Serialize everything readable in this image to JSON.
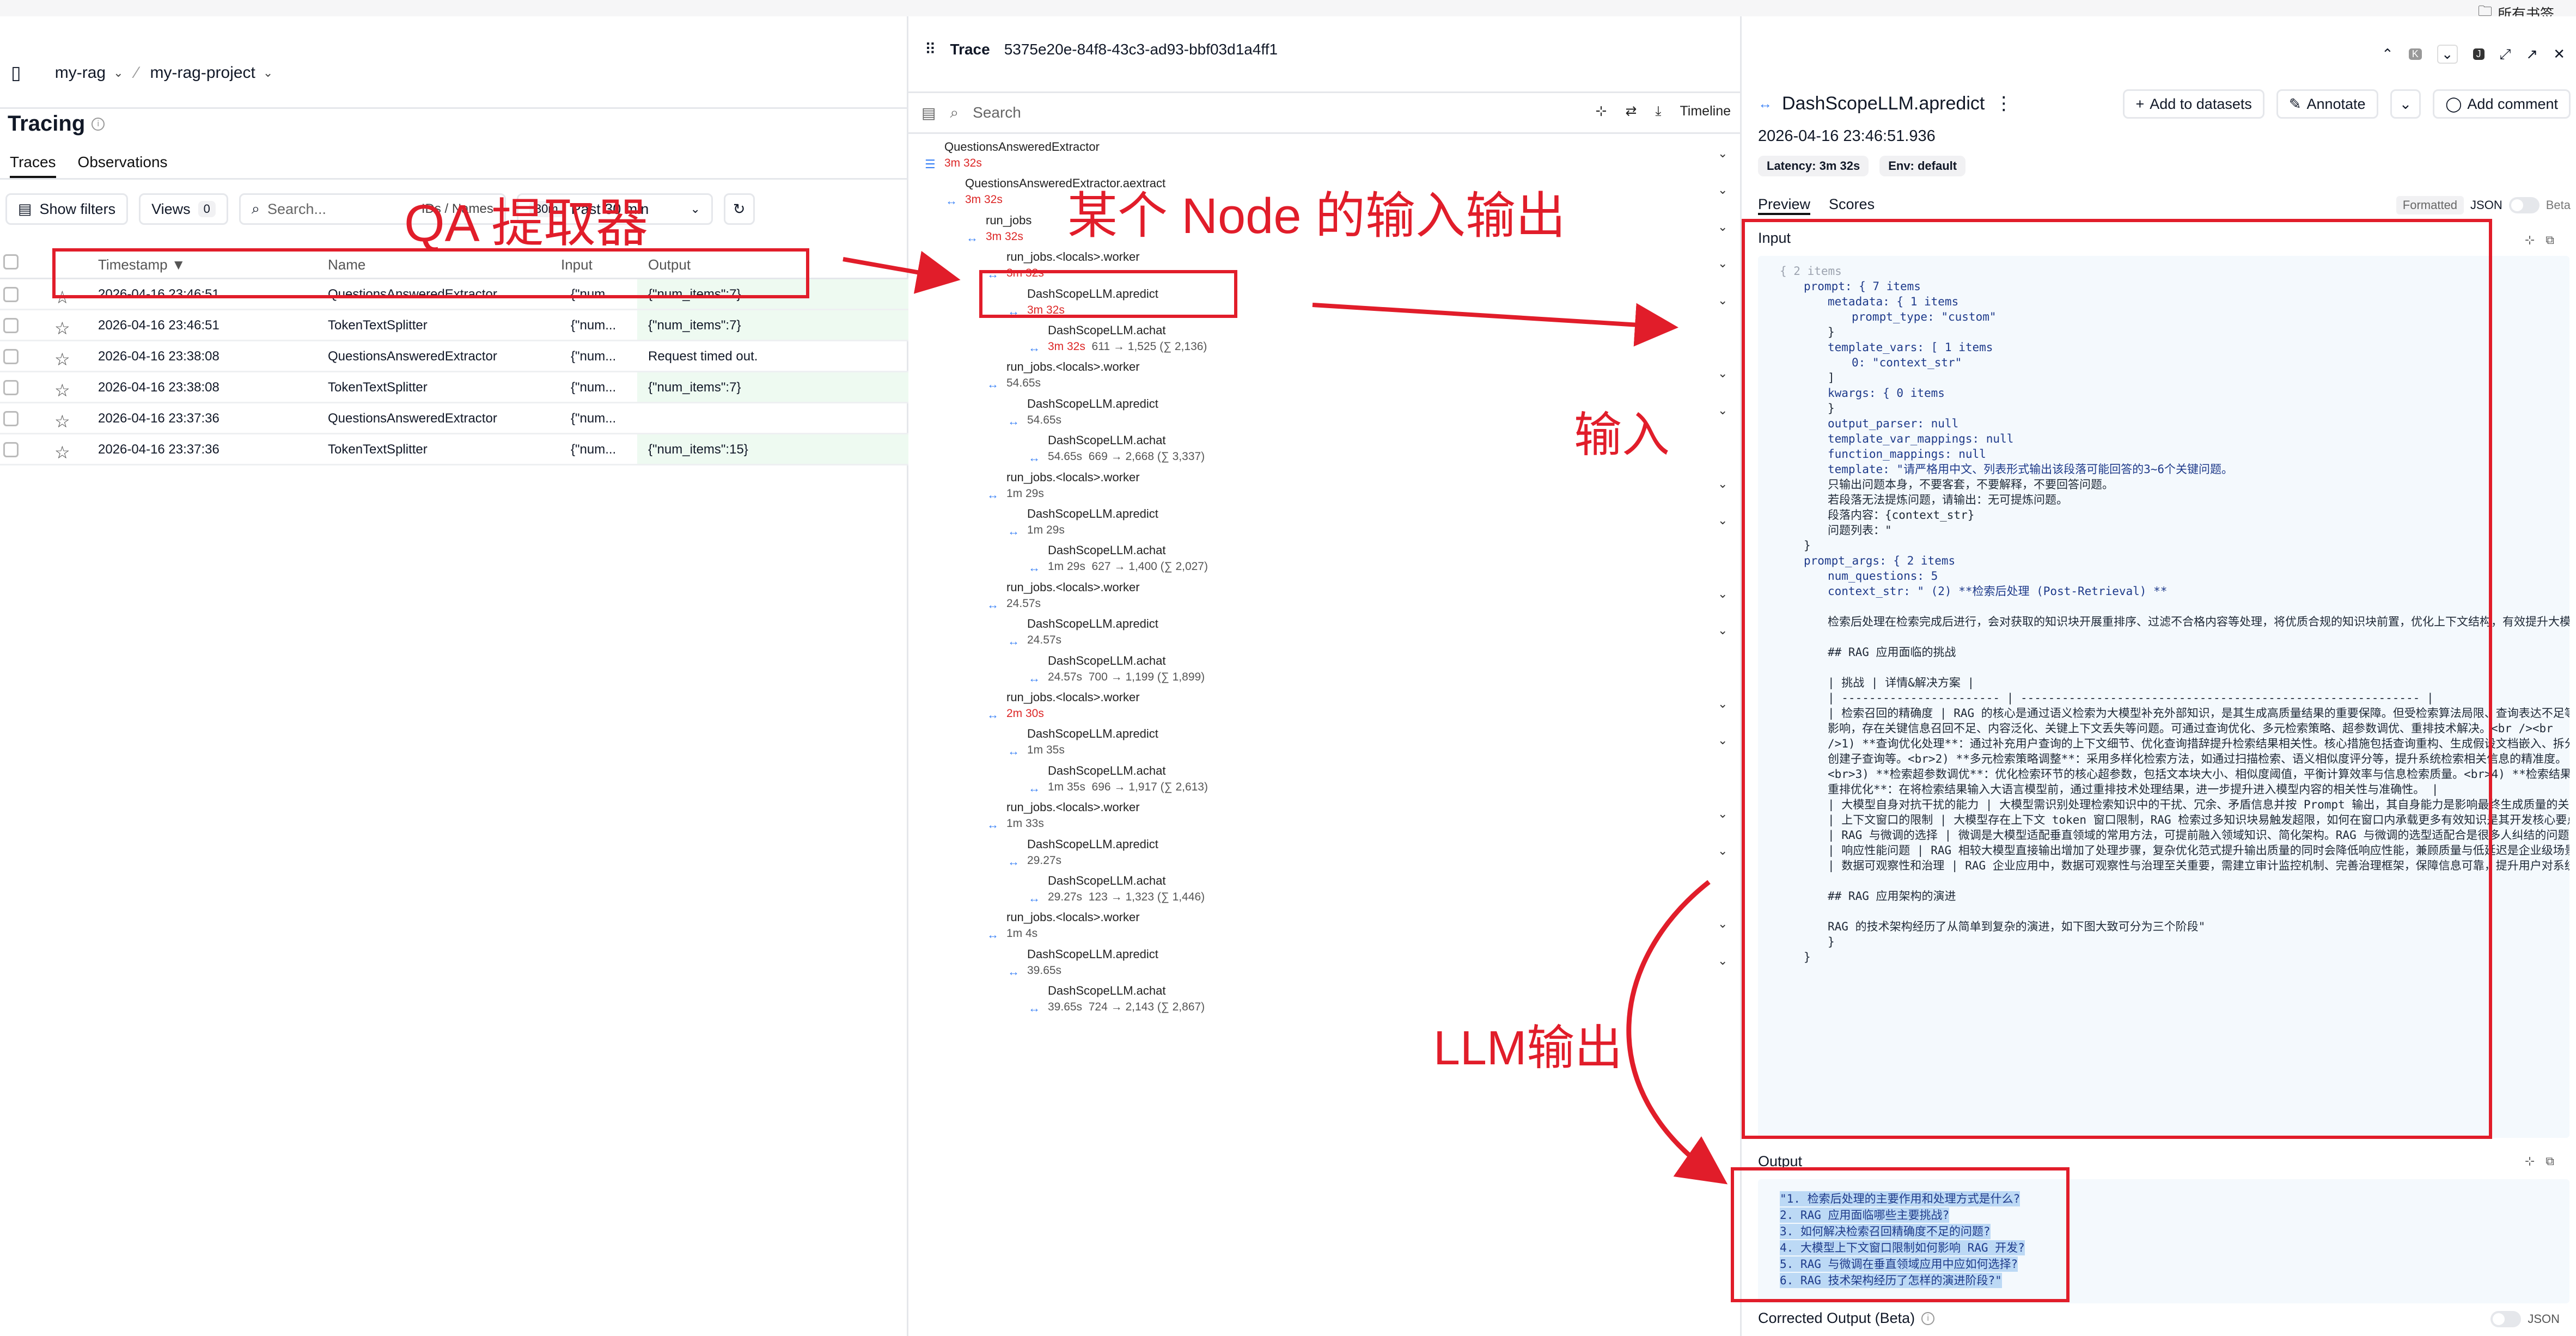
{
  "browser": {
    "bookmarks_label": "所有书签"
  },
  "left": {
    "breadcrumb": {
      "org": "my-rag",
      "project": "my-rag-project"
    },
    "title": "Tracing",
    "tabs": [
      "Traces",
      "Observations"
    ],
    "filters": {
      "show_filters": "Show filters",
      "views_label": "Views",
      "views_count": "0",
      "search_placeholder": "Search...",
      "ids_names": "IDs / Names",
      "range_badge": "30m",
      "range_label": "Past 30 min"
    },
    "columns": {
      "timestamp": "Timestamp ▼",
      "name": "Name",
      "input": "Input",
      "output": "Output"
    },
    "rows": [
      {
        "timestamp": "2026-04-16 23:46:51",
        "name": "QuestionsAnsweredExtractor",
        "input": "{\"num...",
        "output": "{\"num_items\":7}"
      },
      {
        "timestamp": "2026-04-16 23:46:51",
        "name": "TokenTextSplitter",
        "input": "{\"num...",
        "output": "{\"num_items\":7}"
      },
      {
        "timestamp": "2026-04-16 23:38:08",
        "name": "QuestionsAnsweredExtractor",
        "input": "{\"num...",
        "output": "Request timed out."
      },
      {
        "timestamp": "2026-04-16 23:38:08",
        "name": "TokenTextSplitter",
        "input": "{\"num...",
        "output": "{\"num_items\":7}"
      },
      {
        "timestamp": "2026-04-16 23:37:36",
        "name": "QuestionsAnsweredExtractor",
        "input": "{\"num...",
        "output": ""
      },
      {
        "timestamp": "2026-04-16 23:37:36",
        "name": "TokenTextSplitter",
        "input": "{\"num...",
        "output": "{\"num_items\":15}"
      }
    ]
  },
  "middle": {
    "trace_label": "Trace",
    "trace_id": "5375e20e-84f8-43c3-ad93-bbf03d1a4ff1",
    "search_placeholder": "Search",
    "timeline_label": "Timeline",
    "tree": [
      {
        "name": "QuestionsAnsweredExtractor",
        "latency": "3m 32s",
        "red": true
      },
      {
        "name": "QuestionsAnsweredExtractor.aextract",
        "latency": "3m 32s",
        "red": true
      },
      {
        "name": "run_jobs",
        "latency": "3m 32s",
        "red": true
      },
      {
        "name": "run_jobs.<locals>.worker",
        "latency": "3m 32s",
        "red": true
      },
      {
        "name": "DashScopeLLM.apredict",
        "latency": "3m 32s",
        "red": true
      },
      {
        "name": "DashScopeLLM.achat",
        "latency": "3m 32s",
        "red": true,
        "tokens": "611 → 1,525 (∑ 2,136)"
      },
      {
        "name": "run_jobs.<locals>.worker",
        "latency": "54.65s"
      },
      {
        "name": "DashScopeLLM.apredict",
        "latency": "54.65s"
      },
      {
        "name": "DashScopeLLM.achat",
        "latency": "54.65s",
        "tokens": "669 → 2,668 (∑ 3,337)"
      },
      {
        "name": "run_jobs.<locals>.worker",
        "latency": "1m 29s"
      },
      {
        "name": "DashScopeLLM.apredict",
        "latency": "1m 29s"
      },
      {
        "name": "DashScopeLLM.achat",
        "latency": "1m 29s",
        "tokens": "627 → 1,400 (∑ 2,027)"
      },
      {
        "name": "run_jobs.<locals>.worker",
        "latency": "24.57s"
      },
      {
        "name": "DashScopeLLM.apredict",
        "latency": "24.57s"
      },
      {
        "name": "DashScopeLLM.achat",
        "latency": "24.57s",
        "tokens": "700 → 1,199 (∑ 1,899)"
      },
      {
        "name": "run_jobs.<locals>.worker",
        "latency": "2m 30s",
        "red": true
      },
      {
        "name": "DashScopeLLM.apredict",
        "latency": "1m 35s"
      },
      {
        "name": "DashScopeLLM.achat",
        "latency": "1m 35s",
        "tokens": "696 → 1,917 (∑ 2,613)"
      },
      {
        "name": "run_jobs.<locals>.worker",
        "latency": "1m 33s"
      },
      {
        "name": "DashScopeLLM.apredict",
        "latency": "29.27s"
      },
      {
        "name": "DashScopeLLM.achat",
        "latency": "29.27s",
        "tokens": "123 → 1,323 (∑ 1,446)"
      },
      {
        "name": "run_jobs.<locals>.worker",
        "latency": "1m 4s"
      },
      {
        "name": "DashScopeLLM.apredict",
        "latency": "39.65s"
      },
      {
        "name": "DashScopeLLM.achat",
        "latency": "39.65s",
        "tokens": "724 → 2,143 (∑ 2,867)"
      }
    ]
  },
  "right": {
    "title": "DashScopeLLM.apredict",
    "add_to_datasets": "Add to datasets",
    "annotate": "Annotate",
    "add_comment": "Add comment",
    "timestamp": "2026-04-16 23:46:51.936",
    "latency_chip": "Latency: 3m 32s",
    "env_chip": "Env: default",
    "tabs": [
      "Preview",
      "Scores"
    ],
    "formatted_label": "Formatted",
    "json_label": "JSON",
    "beta_label": "Beta",
    "input_label": "Input",
    "output_label": "Output",
    "corrected_label": "Corrected Output (Beta)",
    "input_lines": [
      "{ 2 items",
      "prompt: { 7 items",
      "metadata: { 1 items",
      "prompt_type: \"custom\"",
      "}",
      "template_vars: [ 1 items",
      "0: \"context_str\"",
      "]",
      "kwargs: { 0 items",
      "}",
      "output_parser: null",
      "template_var_mappings: null",
      "function_mappings: null",
      "template: \"请严格用中文、列表形式输出该段落可能回答的3~6个关键问题。",
      "只输出问题本身，不要客套，不要解释，不要回答问题。",
      "若段落无法提炼问题，请输出：无可提炼问题。",
      "段落内容：{context_str}",
      "问题列表：\"",
      "}",
      "prompt_args: { 2 items",
      "num_questions: 5",
      "context_str: \" (2) **检索后处理 (Post-Retrieval) **",
      "",
      "检索后处理在检索完成后进行，会对获取的知识块开展重排序、过滤不合格内容等处理，将优质合规的知识块前置，优化上下文结构，有效提升大模型输出内容的质量。",
      "",
      "## RAG 应用面临的挑战",
      "",
      "| 挑战                    | 详情&解决方案                                               |",
      "| ----------------------- | ---------------------------------------------------------- |",
      "| 检索召回的精确度         | RAG 的核心是通过语义检索为大模型补充外部知识，是其生成高质量结果的重要保障。但受检索算法局限、查询表达不足等影响，存在关键信息召回不足、内容泛化、关键上下文丢失等问题。可通过查询优化、多元检索策略、超参数调优、重排技术解决。<br /><br />1) **查询优化处理**：通过补充用户查询的上下文细节、优化查询措辞提升检索结果相关性。核心措施包括查询重构、生成假设文档嵌入、拆分创建子查询等。<br>2) **多元检索策略调整**：采用多样化检索方法，如通过扫描检索、语义相似度评分等，提升系统检索相关信息的精准度。<br>3) **检索超参数调优**：优化检索环节的核心超参数，包括文本块大小、相似度阈值，平衡计算效率与信息检索质量。<br>4) **检索结果重排优化**：在将检索结果输入大语言模型前，通过重排技术处理结果，进一步提升进入模型内容的相关性与准确性。 |",
      "| 大模型自身对抗干扰的能力 | 大模型需识别处理检索知识中的干扰、冗余、矛盾信息并按 Prompt 输出，其自身能力是影响最终生成质量的关键因素。 |",
      "| 上下文窗口的限制         | 大模型存在上下文 token 窗口限制，RAG 检索过多知识块易触发超限，如何在窗口内承载更多有效知识是其开发核心要点之一。 |",
      "| RAG 与微调的选择         | 微调是大模型适配垂直领域的常用方法，可提前融入领域知识、简化架构。RAG 与微调的选型适配合是很多人纠结的问题。 |",
      "| 响应性能问题             | RAG 相较大模型直接输出增加了处理步骤，复杂优化范式提升输出质量的同时会降低响应性能，兼顾质量与低延迟是企业级场景的开发挑战。 |",
      "| 数据可观察性和治理       | RAG 企业应用中，数据可观察性与治理至关重要，需建立审计监控机制、完善治理框架，保障信息可靠，提升用户对系统的信任。 |",
      "",
      "## RAG 应用架构的演进",
      "",
      "RAG 的技术架构经历了从简单到复杂的演进，如下图大致可分为三个阶段\"",
      "}",
      "}"
    ],
    "output_lines": [
      "\"1. 检索后处理的主要作用和处理方式是什么?",
      "2. RAG 应用面临哪些主要挑战?",
      "3. 如何解决检索召回精确度不足的问题?",
      "4. 大模型上下文窗口限制如何影响 RAG 开发?",
      "5. RAG 与微调在垂直领域应用中应如何选择?",
      "6. RAG 技术架构经历了怎样的演进阶段?\""
    ]
  },
  "annotations": {
    "qa_extractor": "QA 提取器",
    "node_io": "某个 Node 的输入输出",
    "input": "输入",
    "llm_output": "LLM输出"
  },
  "colors": {
    "annotation": "#e11d2a",
    "latency_red": "#dc2626",
    "output_green_bg": "#eefaf1",
    "json_bg": "#f4f9fd"
  }
}
